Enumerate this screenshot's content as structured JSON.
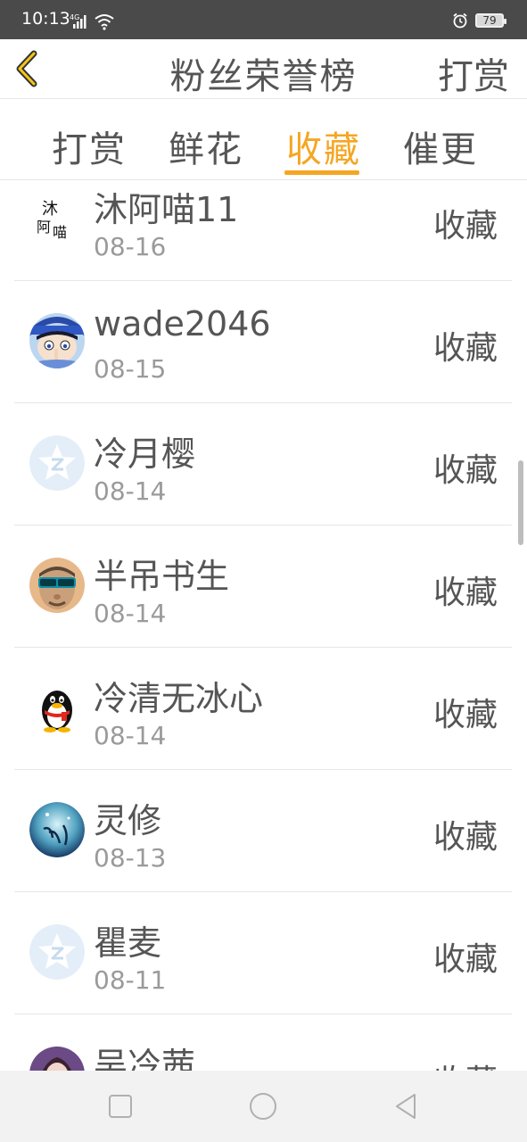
{
  "status_bar": {
    "time": "10:13",
    "network": "4G",
    "battery": "79"
  },
  "header": {
    "title": "粉丝荣誉榜",
    "action": "打赏"
  },
  "tabs": [
    {
      "label": "打赏",
      "active": false
    },
    {
      "label": "鲜花",
      "active": false
    },
    {
      "label": "收藏",
      "active": true
    },
    {
      "label": "催更",
      "active": false
    }
  ],
  "list": [
    {
      "name": "沐阿喵11",
      "date": "08-16",
      "action": "收藏",
      "avatar": "calligraphy-avatar-icon"
    },
    {
      "name": "wade2046",
      "date": "08-15",
      "action": "收藏",
      "avatar": "anime-boy-avatar-icon"
    },
    {
      "name": "冷月樱",
      "date": "08-14",
      "action": "收藏",
      "avatar": "default-star-avatar-icon"
    },
    {
      "name": "半吊书生",
      "date": "08-14",
      "action": "收藏",
      "avatar": "sunglasses-man-avatar-icon"
    },
    {
      "name": "冷清无冰心",
      "date": "08-14",
      "action": "收藏",
      "avatar": "qq-penguin-avatar-icon"
    },
    {
      "name": "灵修",
      "date": "08-13",
      "action": "收藏",
      "avatar": "blue-calligraphy-avatar-icon"
    },
    {
      "name": "瞿麦",
      "date": "08-11",
      "action": "收藏",
      "avatar": "default-star-avatar-icon"
    },
    {
      "name": "吴冷茜",
      "date": "",
      "action": "收藏",
      "avatar": "girl-photo-avatar-icon"
    }
  ],
  "colors": {
    "accent": "#f5a623",
    "text": "#555555",
    "muted": "#9a9a9a",
    "status_bar": "#4a4a4a"
  }
}
